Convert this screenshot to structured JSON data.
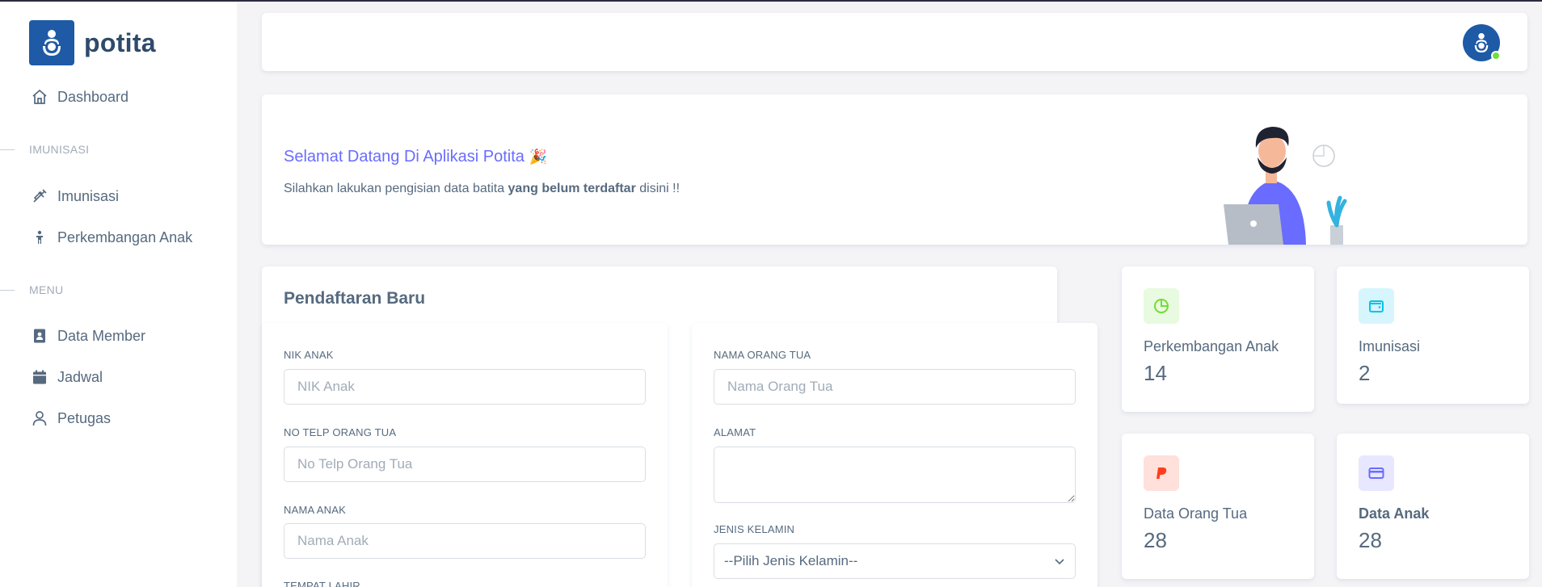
{
  "brand": {
    "name": "potita"
  },
  "sidebar": {
    "dashboard": "Dashboard",
    "section_imunisasi": "IMUNISASI",
    "imunisasi": "Imunisasi",
    "perkembangan": "Perkembangan Anak",
    "section_menu": "MENU",
    "data_member": "Data Member",
    "jadwal": "Jadwal",
    "petugas": "Petugas"
  },
  "welcome": {
    "title": "Selamat Datang Di Aplikasi Potita",
    "emoji": "🎉",
    "text_pre": "Silahkan lakukan pengisian data batita ",
    "text_bold": "yang belum terdaftar",
    "text_post": " disini !!"
  },
  "form": {
    "title": "Pendaftaran Baru",
    "nik_label": "NIK ANAK",
    "nik_placeholder": "NIK Anak",
    "telp_label": "NO TELP ORANG TUA",
    "telp_placeholder": "No Telp Orang Tua",
    "nama_anak_label": "NAMA ANAK",
    "nama_anak_placeholder": "Nama Anak",
    "tempat_lahir_label": "TEMPAT LAHIR",
    "nama_ortu_label": "NAMA ORANG TUA",
    "nama_ortu_placeholder": "Nama Orang Tua",
    "alamat_label": "ALAMAT",
    "jk_label": "JENIS KELAMIN",
    "jk_selected": "--Pilih Jenis Kelamin--"
  },
  "stats": [
    {
      "label": "Perkembangan Anak",
      "value": "14",
      "icon": "pie-chart-icon",
      "color": "#71dd37",
      "bg": "#e8fadf"
    },
    {
      "label": "Imunisasi",
      "value": "2",
      "icon": "wallet-icon",
      "color": "#03c3ec",
      "bg": "#d7f5fc"
    },
    {
      "label": "Data Orang Tua",
      "value": "28",
      "icon": "paypal-icon",
      "color": "#ff3e1d",
      "bg": "#ffe0db"
    },
    {
      "label": "Data Anak",
      "value": "28",
      "icon": "credit-card-icon",
      "color": "#696cff",
      "bg": "#e7e7ff"
    }
  ]
}
